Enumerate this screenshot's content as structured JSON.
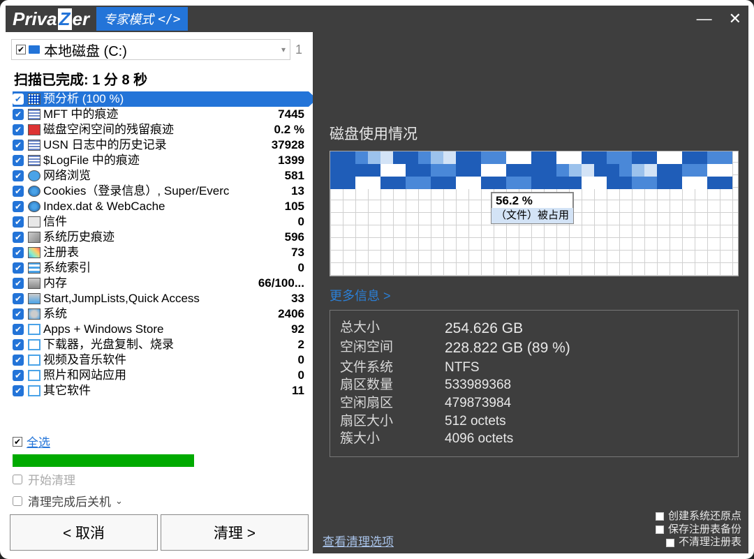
{
  "logo": {
    "text_a": "Priva",
    "text_z": "Z",
    "text_b": "er"
  },
  "mode_badge": "专家模式",
  "mode_code": "</>",
  "drive": {
    "label": "本地磁盘 (C:)",
    "page": "1"
  },
  "scan_status": {
    "prefix": "扫描已完成: ",
    "time": "1 分 8 秒"
  },
  "scan_items": [
    {
      "icon": "grid",
      "label": "预分析 (100 %)",
      "value": "",
      "selected": true
    },
    {
      "icon": "bars",
      "label": "MFT 中的痕迹",
      "value": "7445"
    },
    {
      "icon": "red",
      "label": "磁盘空闲空间的残留痕迹",
      "value": "0.2 %"
    },
    {
      "icon": "bars",
      "label": "USN 日志中的历史记录",
      "value": "37928"
    },
    {
      "icon": "bars",
      "label": "$LogFile 中的痕迹",
      "value": "1399"
    },
    {
      "icon": "globe",
      "label": "网络浏览",
      "value": "581"
    },
    {
      "icon": "finger",
      "label": "Cookies（登录信息）, Super/Everc",
      "value": "13"
    },
    {
      "icon": "finger",
      "label": "Index.dat & WebCache",
      "value": "105"
    },
    {
      "icon": "mail",
      "label": "信件",
      "value": "0"
    },
    {
      "icon": "win",
      "label": "系统历史痕迹",
      "value": "596"
    },
    {
      "icon": "reg",
      "label": "注册表",
      "value": "73"
    },
    {
      "icon": "list",
      "label": "系统索引",
      "value": "0"
    },
    {
      "icon": "chip",
      "label": "内存",
      "value": "66/100..."
    },
    {
      "icon": "quick",
      "label": "Start,JumpLists,Quick Access",
      "value": "33"
    },
    {
      "icon": "gear",
      "label": "系统",
      "value": "2406"
    },
    {
      "icon": "app",
      "label": "Apps + Windows Store",
      "value": "92"
    },
    {
      "icon": "app",
      "label": "下载器，光盘复制、烧录",
      "value": "2"
    },
    {
      "icon": "app",
      "label": "视频及音乐软件",
      "value": "0"
    },
    {
      "icon": "app",
      "label": "照片和网站应用",
      "value": "0"
    },
    {
      "icon": "app",
      "label": "其它软件",
      "value": "11"
    }
  ],
  "select_all": "全选",
  "options": {
    "start_clean": "开始清理",
    "shutdown_after": "清理完成后关机"
  },
  "buttons": {
    "cancel": "< 取消",
    "clean": "清理 >"
  },
  "right": {
    "title": "磁盘使用情况",
    "tip_pct": "56.2 %",
    "tip_sub": "（文件）被占用",
    "more": "更多信息 >",
    "info": [
      {
        "k": "总大小",
        "v": "254.626 GB",
        "big": true
      },
      {
        "k": "空闲空间",
        "v": "228.822 GB (89 %)",
        "big": true
      },
      {
        "k": "文件系统",
        "v": "NTFS"
      },
      {
        "k": "扇区数量",
        "v": "533989368"
      },
      {
        "k": "空闲扇区",
        "v": "479873984"
      },
      {
        "k": "扇区大小",
        "v": "512 octets"
      },
      {
        "k": "簇大小",
        "v": "4096 octets"
      }
    ]
  },
  "footer": {
    "view_options": "查看清理选项",
    "checks": [
      "创建系统还原点",
      "保存注册表备份",
      "不清理注册表"
    ]
  }
}
